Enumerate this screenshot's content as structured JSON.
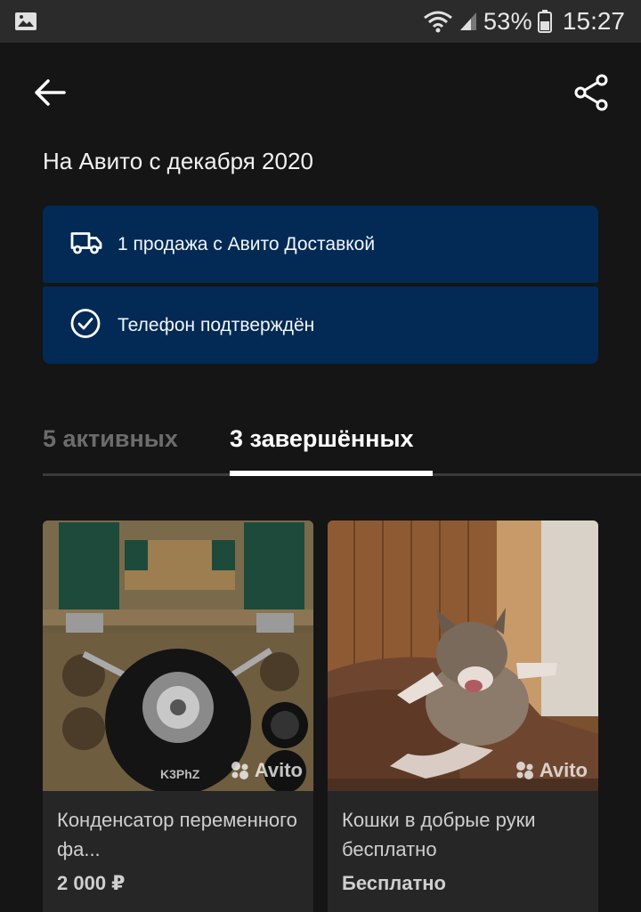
{
  "status_bar": {
    "battery": "53%",
    "time": "15:27"
  },
  "header": {
    "back_icon": "arrow-left-icon",
    "share_icon": "share-icon"
  },
  "profile": {
    "since": "На Авито с декабря 2020"
  },
  "badges": [
    {
      "icon": "truck-icon",
      "label": "1 продажа с Авито Доставкой"
    },
    {
      "icon": "check-circle-icon",
      "label": "Телефон подтверждён"
    }
  ],
  "tabs": [
    {
      "label": "5 активных",
      "active": false
    },
    {
      "label": "3 завершённых",
      "active": true
    }
  ],
  "listings": [
    {
      "title": "Конденсатор переменного фа...",
      "price": "2 000 ₽",
      "watermark": "Avito"
    },
    {
      "title": "Кошки в добрые руки бесплатно",
      "price": "Бесплатно",
      "watermark": "Avito"
    }
  ],
  "colors": {
    "background": "#151515",
    "badge": "#022a55",
    "card": "#262626",
    "tab_inactive": "#6c6c6c"
  }
}
